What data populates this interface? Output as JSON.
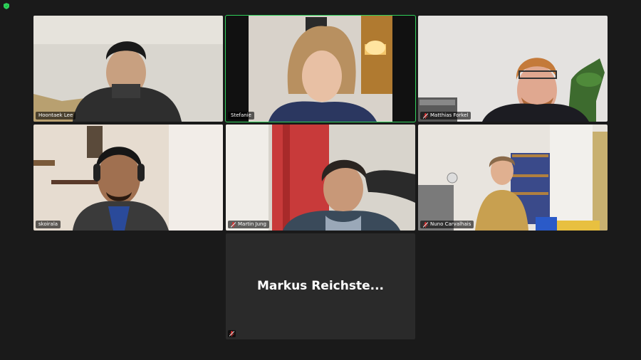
{
  "app": {
    "accent": "#2fcf5a",
    "background": "#1a1a1a"
  },
  "participants": [
    {
      "name": "Hoontaek Lee",
      "muted": false,
      "icon": "none"
    },
    {
      "name": "Stefanie",
      "muted": false,
      "active_speaker": true,
      "icon": "none"
    },
    {
      "name": "Matthias Forkel",
      "muted": true,
      "icon": "mic-muted-icon"
    },
    {
      "name": "skoirala",
      "muted": false,
      "icon": "none"
    },
    {
      "name": "Martin Jung",
      "muted": true,
      "icon": "mic-muted-icon"
    },
    {
      "name": "Nuno Carvalhais",
      "muted": true,
      "icon": "mic-muted-icon"
    },
    {
      "name": "Markus Reichste...",
      "muted": true,
      "video_off": true,
      "icon": "mic-muted-icon"
    }
  ]
}
